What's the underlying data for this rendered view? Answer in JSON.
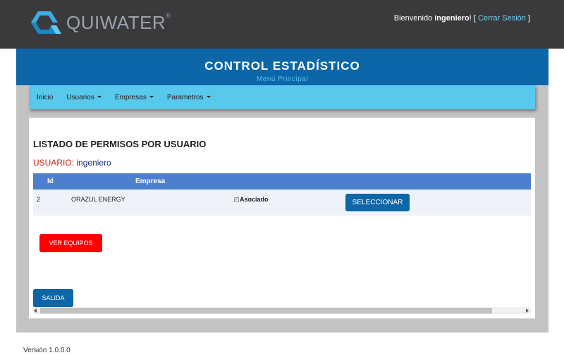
{
  "brand": {
    "logo_text": "QUIWATER",
    "trademark": "®",
    "colors": {
      "dark_bar": "#3a3a3c",
      "primary_blue": "#0d66a8",
      "nav_cyan": "#58c8ec",
      "table_head": "#4e7fcf",
      "danger_red": "#ff0000"
    }
  },
  "header": {
    "welcome_prefix": "Bienvenido",
    "username": "ingeniero",
    "welcome_bang": "!",
    "bracket_open": "[",
    "logout_label": "Cerrar Sesión",
    "bracket_close": "]"
  },
  "app": {
    "title": "CONTROL ESTADÍSTICO",
    "subtitle": "Menú Principal"
  },
  "nav": {
    "items": [
      {
        "label": "Inicio",
        "dropdown": false
      },
      {
        "label": "Usuarios",
        "dropdown": true
      },
      {
        "label": "Empresas",
        "dropdown": true
      },
      {
        "label": "Parametros",
        "dropdown": true
      }
    ]
  },
  "panel": {
    "title": "LISTADO DE PERMISOS POR USUARIO",
    "user_label": "USUARIO:",
    "user_value": "ingeniero",
    "table": {
      "columns": [
        "Id",
        "Empresa"
      ],
      "rows": [
        {
          "id": "2",
          "empresa": "ORAZUL ENERGY",
          "check_label": "Asociado",
          "checked": true,
          "action_label": "SELECCIONAR"
        }
      ]
    },
    "ver_equipos_label": "VER EQUIPOS",
    "salida_label": "SALIDA"
  },
  "footer": {
    "version": "Versión 1.0.0.0"
  }
}
